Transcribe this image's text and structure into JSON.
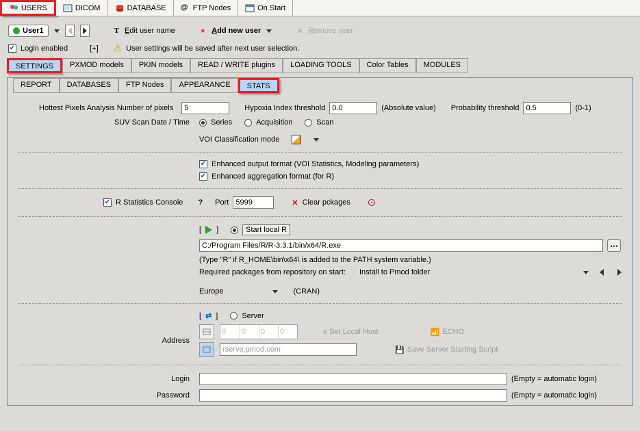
{
  "top_tabs": {
    "users": "USERS",
    "dicom": "DICOM",
    "database": "DATABASE",
    "ftp": "FTP Nodes",
    "onstart": "On Start"
  },
  "user_toolbar": {
    "combo_value": "User1",
    "edit_label": "Edit user name",
    "add_label": "Add new user",
    "remove_label": "Remove user"
  },
  "login_row": {
    "enabled_label": "Login enabled",
    "plus": "[+]",
    "warn_text": "User settings will be saved after next user selection."
  },
  "level2_tabs": {
    "settings": "SETTINGS",
    "pxmod": "PXMOD models",
    "pkin": "PKIN models",
    "rw": "READ / WRITE plugins",
    "loading": "LOADING TOOLS",
    "color": "Color Tables",
    "modules": "MODULES"
  },
  "level3_tabs": {
    "report": "REPORT",
    "databases": "DATABASES",
    "ftp": "FTP Nodes",
    "appearance": "APPEARANCE",
    "stats": "STATS"
  },
  "stats": {
    "hottest_label": "Hottest Pixels Analysis Number of pixels",
    "hottest_value": "5",
    "hypoxia_label": "Hypoxia Index threshold",
    "hypoxia_value": "0.0",
    "hypoxia_note": "(Absolute value)",
    "prob_label": "Probability threshold",
    "prob_value": "0.5",
    "prob_note": "(0-1)",
    "suv_label": "SUV Scan Date / Time",
    "radio_series": "Series",
    "radio_acq": "Acquisition",
    "radio_scan": "Scan",
    "voi_label": "VOI Classification mode",
    "enh_out": "Enhanced output format (VOI Statistics, Modeling parameters)",
    "enh_agg": "Enhanced aggregation format (for R)",
    "rconsole_label": "R Statistics Console",
    "port_label": "Port",
    "port_value": "5999",
    "clear_label": "Clear pckages",
    "start_label": "Start local R",
    "rpath": "C:/Program Files/R/R-3.3.1/bin/x64/R.exe",
    "rpath_hint": "(Type \"R\" if R_HOME\\bin\\x64\\ is added to the PATH system variable.)",
    "req_label": "Required packages from repository on start:",
    "req_value": "Install to Pmod folder",
    "region": "Europe",
    "region_note": "(CRAN)",
    "server_label": "Server",
    "address_label": "Address",
    "ip0": "0",
    "ip1": "0",
    "ip2": "0",
    "ip3": "0",
    "setlocal": "Set Local Host",
    "echo": "ECHO",
    "rserve_ph": "rserve.pmod.com",
    "savescript": "Save Server Starting Script",
    "login_label": "Login",
    "login_hint": "(Empty = automatic login)",
    "pwd_label": "Password",
    "pwd_hint": "(Empty = automatic login)",
    "q": "?",
    "br_l": "[",
    "br_r": "]"
  }
}
